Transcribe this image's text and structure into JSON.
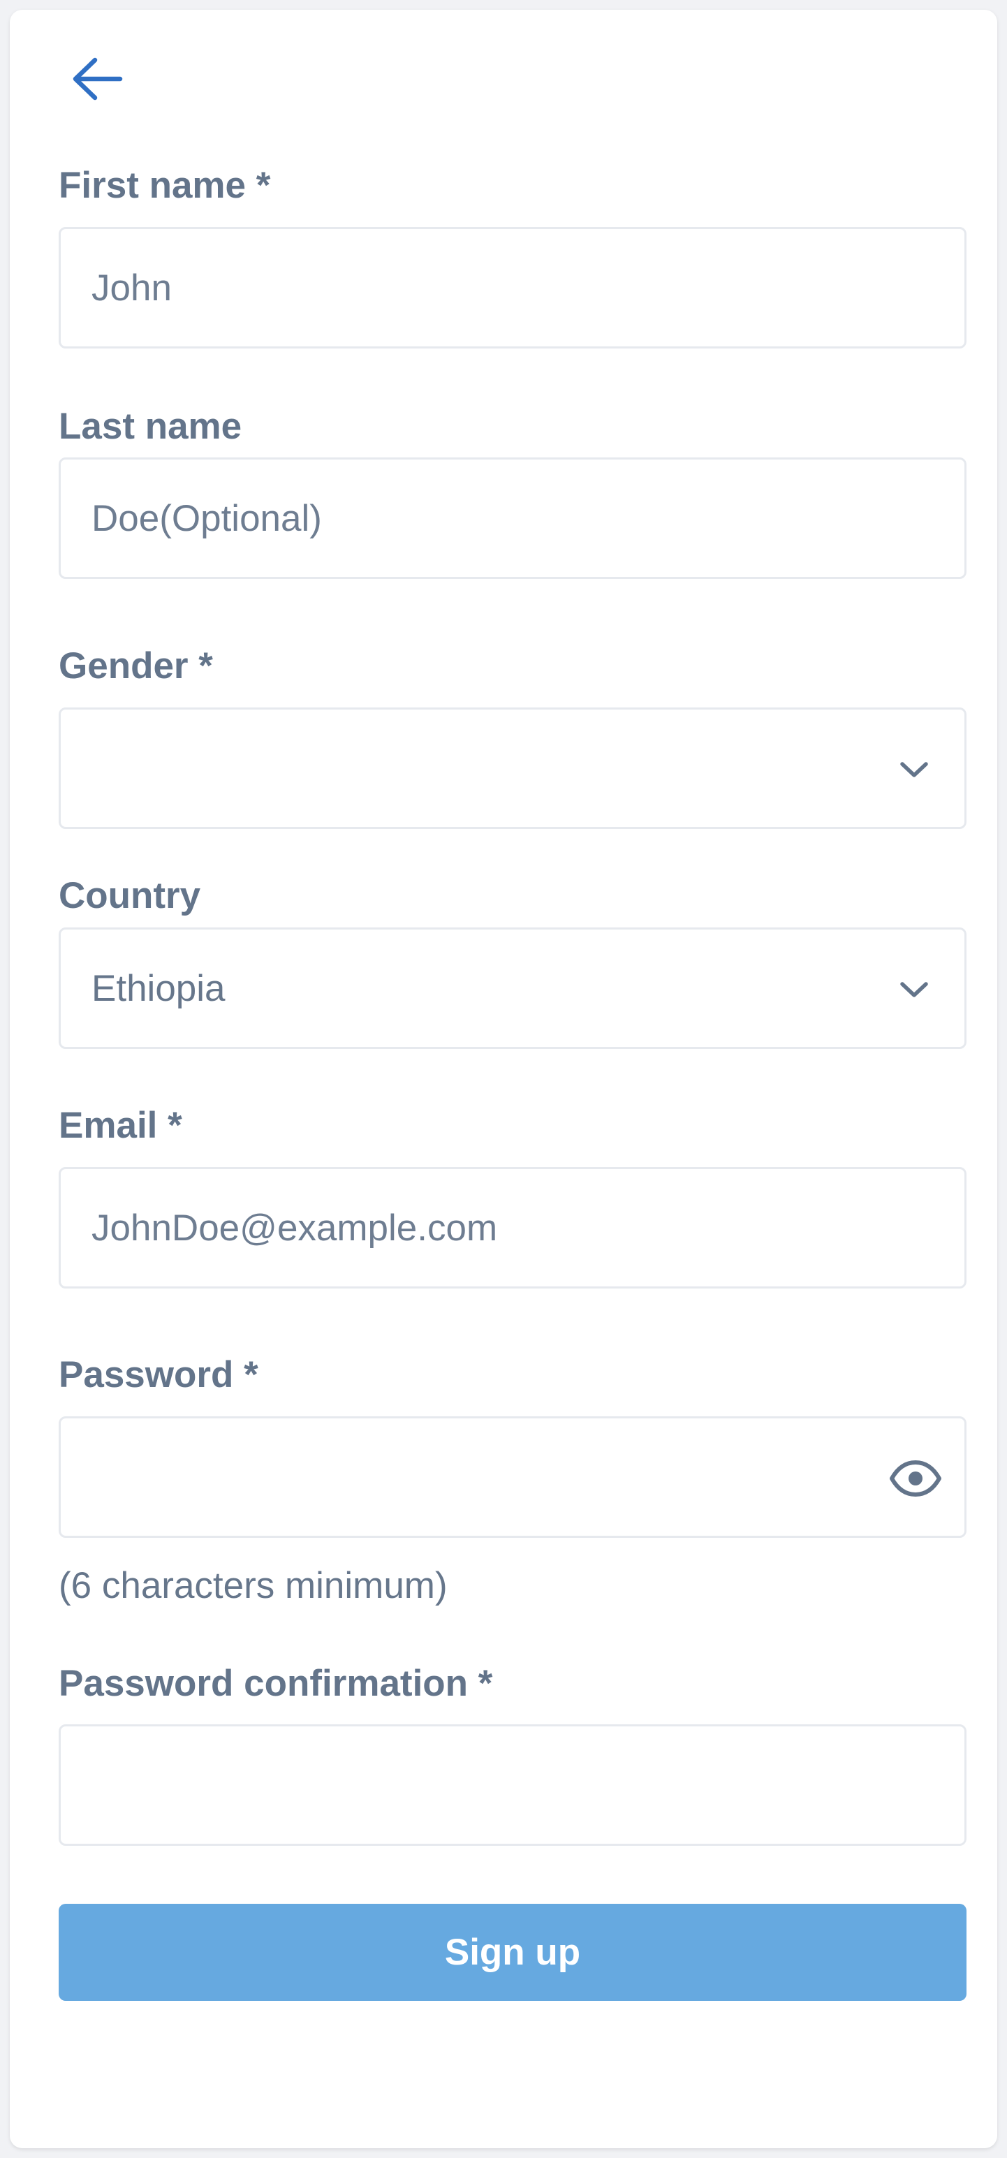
{
  "form": {
    "first_name": {
      "label": "First name *",
      "placeholder": "John",
      "value": ""
    },
    "last_name": {
      "label": "Last name",
      "placeholder": "Doe(Optional)",
      "value": ""
    },
    "gender": {
      "label": "Gender *",
      "selected": ""
    },
    "country": {
      "label": "Country",
      "selected": "Ethiopia"
    },
    "email": {
      "label": "Email *",
      "placeholder": "JohnDoe@example.com",
      "value": ""
    },
    "password": {
      "label": "Password *",
      "value": "",
      "hint": "(6 characters minimum)"
    },
    "password_confirmation": {
      "label": "Password confirmation *",
      "value": ""
    },
    "submit_label": "Sign up"
  },
  "icons": {
    "back": "arrow-left-icon",
    "dropdown": "chevron-down-icon",
    "reveal_password": "eye-icon"
  },
  "colors": {
    "accent": "#2f6fc4",
    "button": "#66a9e0",
    "label": "#63748a",
    "border": "#e6e9ee",
    "background": "#f1f2f5"
  }
}
